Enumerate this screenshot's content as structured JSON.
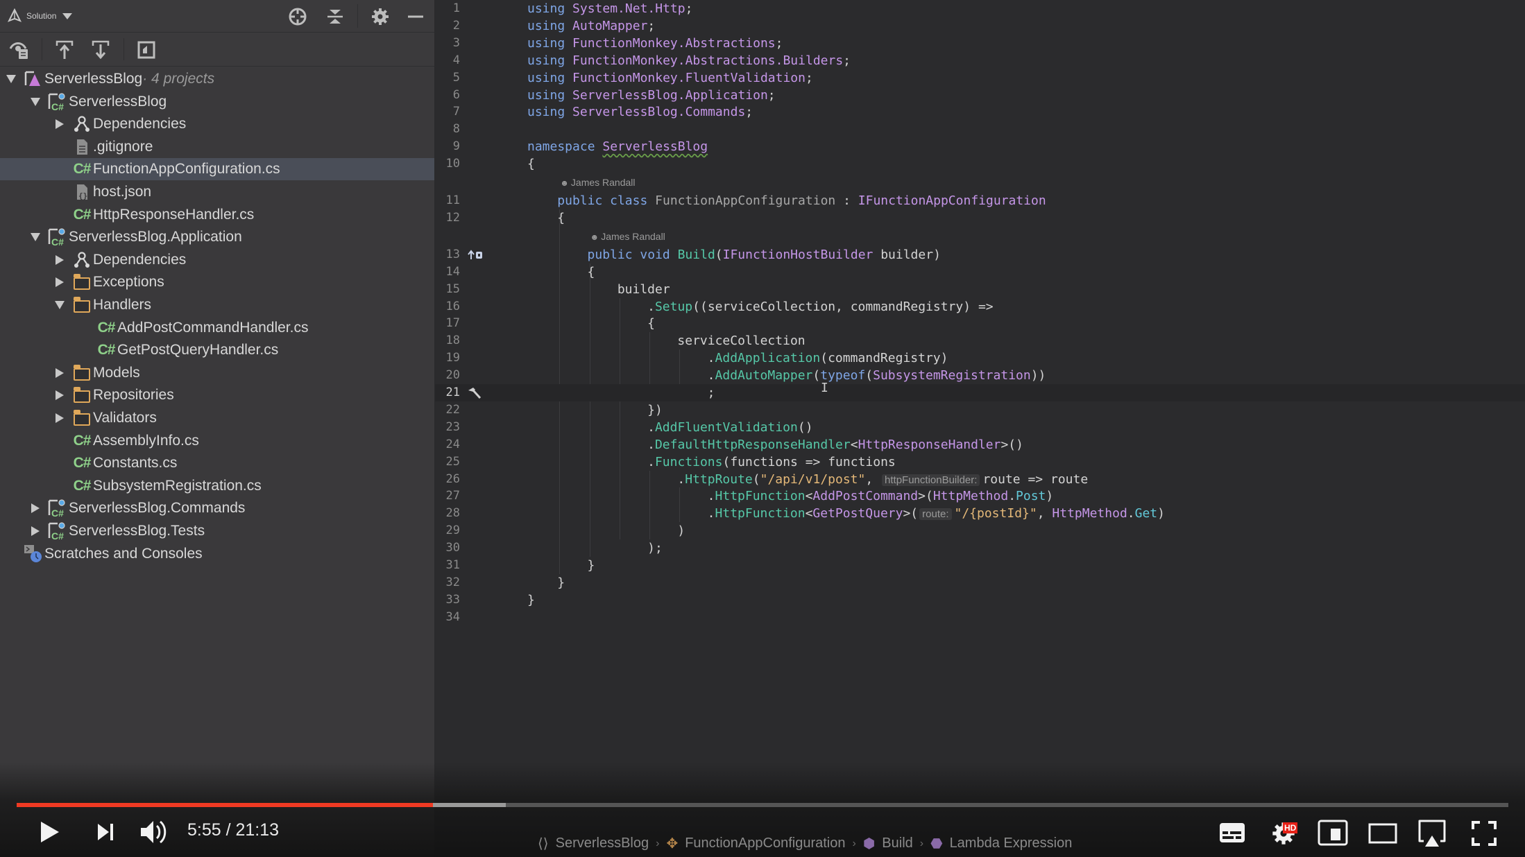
{
  "sidebar": {
    "toolbar": {
      "solution_label": "Solution",
      "icons": [
        "solution-icon",
        "chevron-down-icon",
        "locate-icon",
        "collapse-all-icon",
        "gear-icon",
        "minimize-icon",
        "show-files-icon",
        "scroll-from-source-icon",
        "scroll-to-source-icon",
        "preview-icon"
      ]
    },
    "tree": [
      {
        "level": 0,
        "arrow": "expanded",
        "icon": "solution",
        "label": "ServerlessBlog",
        "sub": " · 4 projects"
      },
      {
        "level": 1,
        "arrow": "expanded",
        "icon": "csproj",
        "label": "ServerlessBlog"
      },
      {
        "level": 2,
        "arrow": "collapsed",
        "icon": "dependencies",
        "label": "Dependencies"
      },
      {
        "level": 2,
        "arrow": "none",
        "icon": "file",
        "label": ".gitignore"
      },
      {
        "level": 2,
        "arrow": "none",
        "icon": "cs",
        "label": "FunctionAppConfiguration.cs",
        "selected": true
      },
      {
        "level": 2,
        "arrow": "none",
        "icon": "json",
        "label": "host.json"
      },
      {
        "level": 2,
        "arrow": "none",
        "icon": "cs",
        "label": "HttpResponseHandler.cs"
      },
      {
        "level": 1,
        "arrow": "expanded",
        "icon": "csproj",
        "label": "ServerlessBlog.Application"
      },
      {
        "level": 2,
        "arrow": "collapsed",
        "icon": "dependencies",
        "label": "Dependencies"
      },
      {
        "level": 2,
        "arrow": "collapsed",
        "icon": "folder",
        "label": "Exceptions"
      },
      {
        "level": 2,
        "arrow": "expanded",
        "icon": "folder",
        "label": "Handlers"
      },
      {
        "level": 3,
        "arrow": "none",
        "icon": "cs",
        "label": "AddPostCommandHandler.cs"
      },
      {
        "level": 3,
        "arrow": "none",
        "icon": "cs",
        "label": "GetPostQueryHandler.cs"
      },
      {
        "level": 2,
        "arrow": "collapsed",
        "icon": "folder",
        "label": "Models"
      },
      {
        "level": 2,
        "arrow": "collapsed",
        "icon": "folder",
        "label": "Repositories"
      },
      {
        "level": 2,
        "arrow": "collapsed",
        "icon": "folder",
        "label": "Validators"
      },
      {
        "level": 2,
        "arrow": "none",
        "icon": "cs",
        "label": "AssemblyInfo.cs"
      },
      {
        "level": 2,
        "arrow": "none",
        "icon": "cs",
        "label": "Constants.cs"
      },
      {
        "level": 2,
        "arrow": "none",
        "icon": "cs",
        "label": "SubsystemRegistration.cs"
      },
      {
        "level": 1,
        "arrow": "collapsed",
        "icon": "csproj",
        "label": "ServerlessBlog.Commands"
      },
      {
        "level": 1,
        "arrow": "collapsed",
        "icon": "csproj",
        "label": "ServerlessBlog.Tests"
      },
      {
        "level": 0,
        "arrow": "none",
        "icon": "scratches",
        "label": "Scratches and Consoles"
      }
    ]
  },
  "editor": {
    "current_line": 21,
    "code_lens_author": "James Randall",
    "lines": [
      {
        "n": 1,
        "tokens": [
          [
            "kw",
            "using "
          ],
          [
            "ty",
            "System.Net.Http"
          ],
          [
            "pl",
            ";"
          ]
        ]
      },
      {
        "n": 2,
        "tokens": [
          [
            "kw",
            "using "
          ],
          [
            "ty",
            "AutoMapper"
          ],
          [
            "pl",
            ";"
          ]
        ]
      },
      {
        "n": 3,
        "tokens": [
          [
            "kw",
            "using "
          ],
          [
            "ty",
            "FunctionMonkey.Abstractions"
          ],
          [
            "pl",
            ";"
          ]
        ]
      },
      {
        "n": 4,
        "tokens": [
          [
            "kw",
            "using "
          ],
          [
            "ty",
            "FunctionMonkey.Abstractions.Builders"
          ],
          [
            "pl",
            ";"
          ]
        ]
      },
      {
        "n": 5,
        "tokens": [
          [
            "kw",
            "using "
          ],
          [
            "ty",
            "FunctionMonkey.FluentValidation"
          ],
          [
            "pl",
            ";"
          ]
        ]
      },
      {
        "n": 6,
        "tokens": [
          [
            "kw",
            "using "
          ],
          [
            "ty",
            "ServerlessBlog.Application"
          ],
          [
            "pl",
            ";"
          ]
        ]
      },
      {
        "n": 7,
        "tokens": [
          [
            "kw",
            "using "
          ],
          [
            "ty",
            "ServerlessBlog.Commands"
          ],
          [
            "pl",
            ";"
          ]
        ]
      },
      {
        "n": 8,
        "tokens": []
      },
      {
        "n": 9,
        "tokens": [
          [
            "kw",
            "namespace "
          ],
          [
            "ty squiggle",
            "ServerlessBlog"
          ]
        ]
      },
      {
        "n": 10,
        "tokens": [
          [
            "pl",
            "{"
          ]
        ]
      },
      {
        "n": 11,
        "lens": true,
        "indent": 1,
        "tokens": [
          [
            "kw",
            "public class "
          ],
          [
            "ty2",
            "FunctionAppConfiguration"
          ],
          [
            "pl",
            " : "
          ],
          [
            "ty",
            "IFunctionAppConfiguration"
          ]
        ]
      },
      {
        "n": 12,
        "indent": 1,
        "tokens": [
          [
            "pl",
            "{"
          ]
        ]
      },
      {
        "n": 13,
        "lens": true,
        "indent": 2,
        "gutter_icon": "implements-icon",
        "tokens": [
          [
            "kw",
            "public void "
          ],
          [
            "fn",
            "Build"
          ],
          [
            "pl",
            "("
          ],
          [
            "ty",
            "IFunctionHostBuilder"
          ],
          [
            "pl",
            " builder)"
          ]
        ]
      },
      {
        "n": 14,
        "indent": 2,
        "tokens": [
          [
            "pl",
            "{"
          ]
        ]
      },
      {
        "n": 15,
        "indent": 3,
        "tokens": [
          [
            "pl",
            "builder"
          ]
        ]
      },
      {
        "n": 16,
        "indent": 4,
        "tokens": [
          [
            "pl",
            "."
          ],
          [
            "fn",
            "Setup"
          ],
          [
            "pl",
            "((serviceCollection, commandRegistry) =>"
          ]
        ]
      },
      {
        "n": 17,
        "indent": 4,
        "tokens": [
          [
            "pl",
            "{"
          ]
        ]
      },
      {
        "n": 18,
        "indent": 5,
        "tokens": [
          [
            "pl",
            "serviceCollection"
          ]
        ]
      },
      {
        "n": 19,
        "indent": 6,
        "tokens": [
          [
            "pl",
            "."
          ],
          [
            "fn",
            "AddApplication"
          ],
          [
            "pl",
            "(commandRegistry)"
          ]
        ]
      },
      {
        "n": 20,
        "indent": 6,
        "tokens": [
          [
            "pl",
            "."
          ],
          [
            "fn",
            "AddAutoMapper"
          ],
          [
            "pl",
            "("
          ],
          [
            "kw",
            "typeof"
          ],
          [
            "pl",
            "("
          ],
          [
            "ty",
            "SubsystemRegistration"
          ],
          [
            "pl",
            "))"
          ]
        ]
      },
      {
        "n": 21,
        "indent": 6,
        "gutter_icon": "hammer-icon",
        "tokens": [
          [
            "pl",
            ";"
          ]
        ]
      },
      {
        "n": 22,
        "indent": 4,
        "tokens": [
          [
            "pl",
            "})"
          ]
        ]
      },
      {
        "n": 23,
        "indent": 4,
        "tokens": [
          [
            "pl",
            "."
          ],
          [
            "fn",
            "AddFluentValidation"
          ],
          [
            "pl",
            "()"
          ]
        ]
      },
      {
        "n": 24,
        "indent": 4,
        "tokens": [
          [
            "pl",
            "."
          ],
          [
            "fn",
            "DefaultHttpResponseHandler"
          ],
          [
            "pl",
            "<"
          ],
          [
            "ty",
            "HttpResponseHandler"
          ],
          [
            "pl",
            ">()"
          ]
        ]
      },
      {
        "n": 25,
        "indent": 4,
        "tokens": [
          [
            "pl",
            "."
          ],
          [
            "fn",
            "Functions"
          ],
          [
            "pl",
            "(functions => functions"
          ]
        ]
      },
      {
        "n": 26,
        "indent": 5,
        "tokens": [
          [
            "pl",
            "."
          ],
          [
            "fn",
            "HttpRoute"
          ],
          [
            "pl",
            "("
          ],
          [
            "str",
            "\"/api/v1/post\""
          ],
          [
            "pl",
            ", "
          ],
          [
            "hint",
            "httpFunctionBuilder:"
          ],
          [
            "pl",
            "route => route"
          ]
        ]
      },
      {
        "n": 27,
        "indent": 6,
        "tokens": [
          [
            "pl",
            "."
          ],
          [
            "fn",
            "HttpFunction"
          ],
          [
            "pl",
            "<"
          ],
          [
            "ty",
            "AddPostCommand"
          ],
          [
            "pl",
            ">("
          ],
          [
            "ty",
            "HttpMethod"
          ],
          [
            "pl",
            "."
          ],
          [
            "prop",
            "Post"
          ],
          [
            "pl",
            ")"
          ]
        ]
      },
      {
        "n": 28,
        "indent": 6,
        "tokens": [
          [
            "pl",
            "."
          ],
          [
            "fn",
            "HttpFunction"
          ],
          [
            "pl",
            "<"
          ],
          [
            "ty",
            "GetPostQuery"
          ],
          [
            "pl",
            ">("
          ],
          [
            "hint",
            "route:"
          ],
          [
            "str",
            "\"/{postId}\""
          ],
          [
            "pl",
            ", "
          ],
          [
            "ty",
            "HttpMethod"
          ],
          [
            "pl",
            "."
          ],
          [
            "prop",
            "Get"
          ],
          [
            "pl",
            ")"
          ]
        ]
      },
      {
        "n": 29,
        "indent": 5,
        "tokens": [
          [
            "pl",
            ")"
          ]
        ]
      },
      {
        "n": 30,
        "indent": 4,
        "tokens": [
          [
            "pl",
            ");"
          ]
        ]
      },
      {
        "n": 31,
        "indent": 2,
        "tokens": [
          [
            "pl",
            "}"
          ]
        ]
      },
      {
        "n": 32,
        "indent": 1,
        "tokens": [
          [
            "pl",
            "}"
          ]
        ]
      },
      {
        "n": 33,
        "tokens": [
          [
            "pl",
            "}"
          ]
        ]
      },
      {
        "n": 34,
        "tokens": []
      }
    ]
  },
  "status": {
    "inspection_icon": "checkmark-icon",
    "breadcrumb": [
      {
        "icon": "namespace-icon",
        "label": "ServerlessBlog"
      },
      {
        "icon": "class-icon",
        "label": "FunctionAppConfiguration"
      },
      {
        "icon": "method-icon",
        "label": "Build"
      },
      {
        "icon": "lambda-icon",
        "label": "Lambda Expression"
      }
    ]
  },
  "player": {
    "current_time": "5:55",
    "duration": "21:13",
    "time_text": "5:55 / 21:13",
    "played_fraction": 0.279,
    "buffered_fraction": 0.328,
    "hd_badge": "HD",
    "accent_color": "#f03a23",
    "buttons": [
      "play-button",
      "next-button",
      "volume-button",
      "subtitles-button",
      "settings-button",
      "miniplayer-button",
      "theater-mode-button",
      "airplay-button",
      "fullscreen-button"
    ]
  }
}
